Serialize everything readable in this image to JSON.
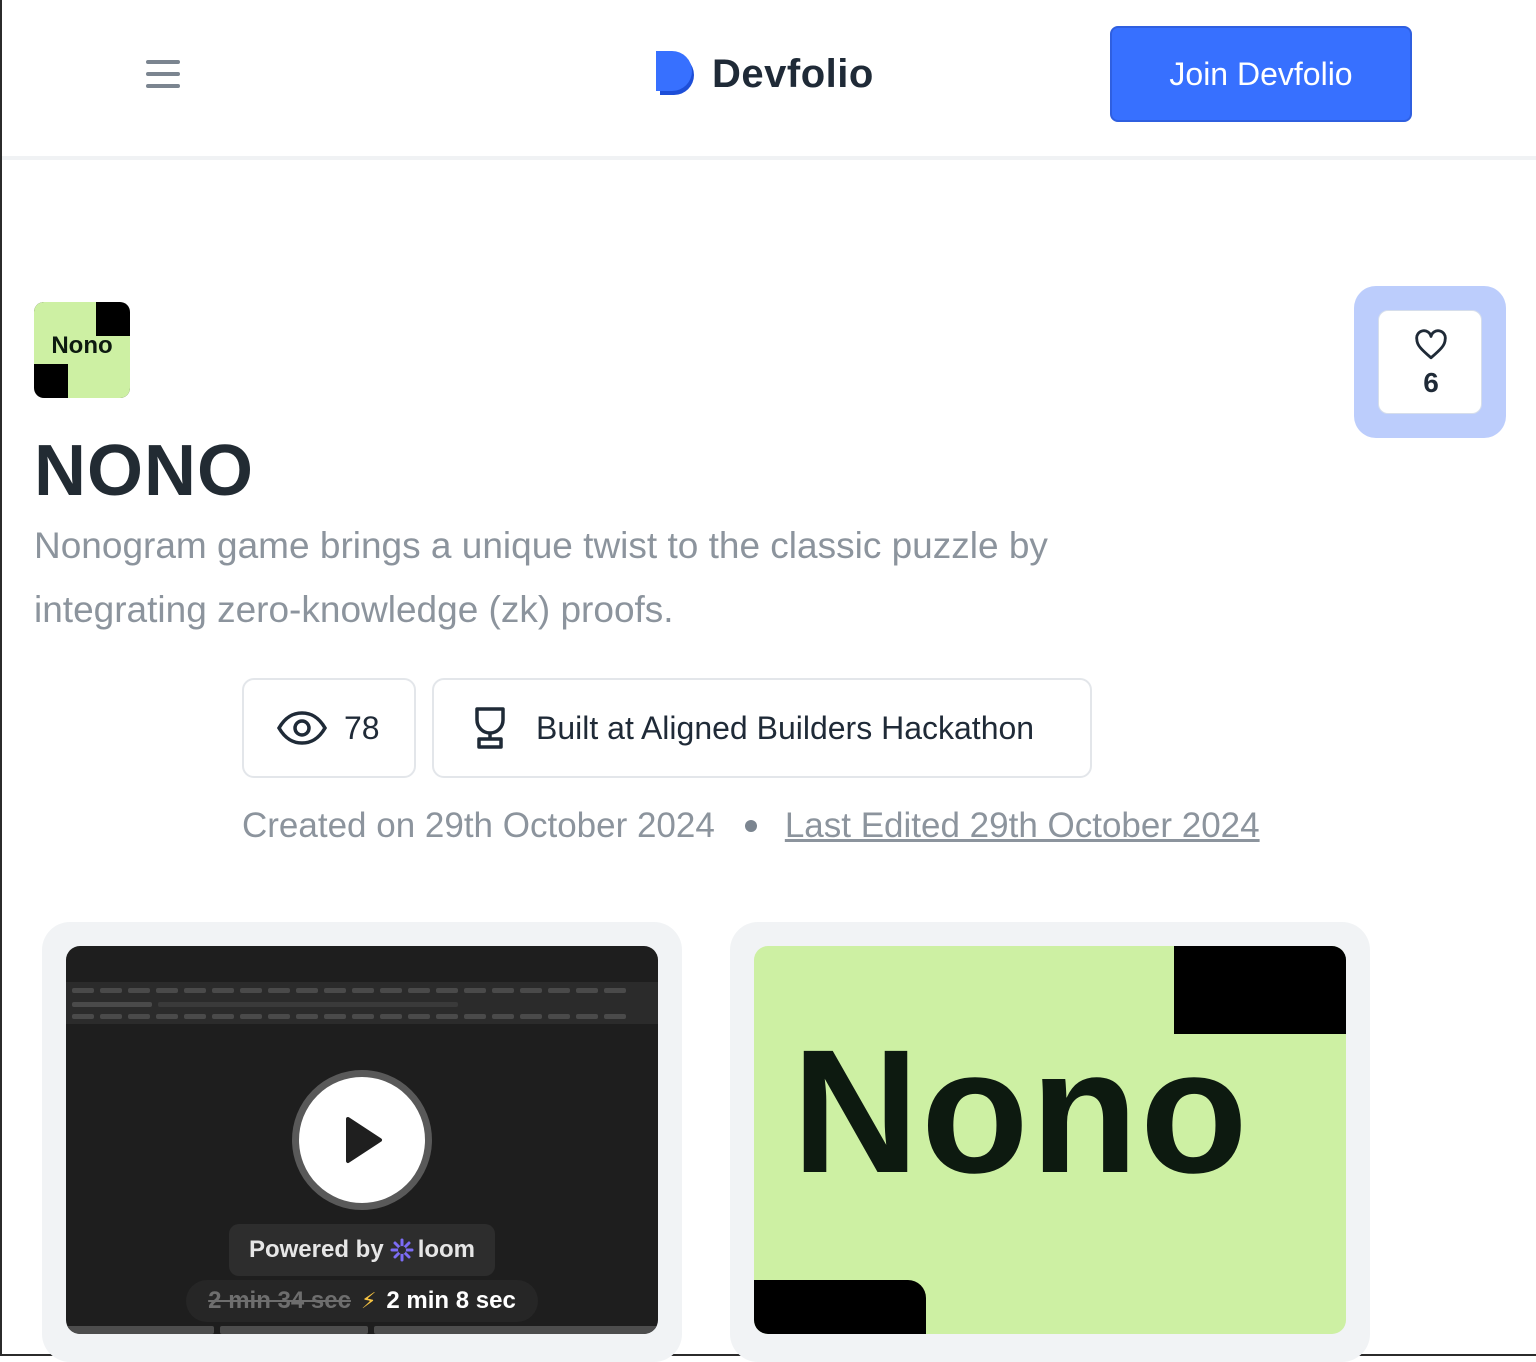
{
  "header": {
    "brand": "Devfolio",
    "join_label": "Join Devfolio",
    "menu_icon": "hamburger-menu-icon"
  },
  "project": {
    "logo_text": "Nono",
    "title": "NONO",
    "tagline": "Nonogram game brings a unique twist to the classic puzzle by integrating zero-knowledge (zk) proofs.",
    "likes": "6",
    "views": "78",
    "hackathon": "Built at Aligned Builders Hackathon",
    "created": "Created on 29th October 2024",
    "edited": "Last Edited 29th October 2024"
  },
  "media": {
    "video": {
      "powered_prefix": "Powered by",
      "powered_brand": "loom",
      "old_duration": "2 min 34 sec",
      "new_duration": "2 min 8 sec"
    },
    "image_text": "Nono"
  },
  "colors": {
    "accent": "#3770ff",
    "like_bg": "#bccdfc",
    "nono_green": "#cdf0a3"
  }
}
